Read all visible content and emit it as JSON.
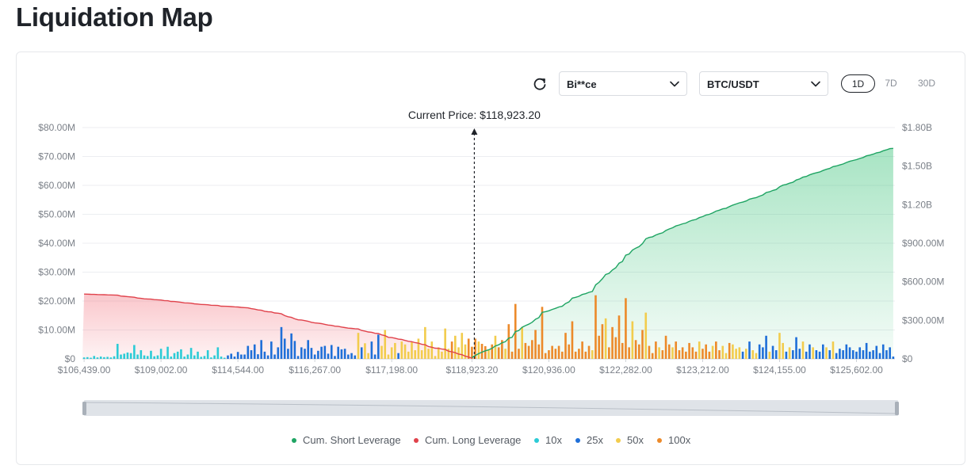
{
  "page": {
    "title": "Liquidation Map"
  },
  "controls": {
    "exchange": "Bi**ce",
    "pair": "BTC/USDT",
    "timeframes": [
      "1D",
      "7D",
      "30D"
    ],
    "active_timeframe": "1D"
  },
  "colors": {
    "short_line": "#1fa463",
    "short_fill": "#2fbf71",
    "long_line": "#e0424b",
    "long_fill": "#f26b77",
    "lev_10x": "#2ccbd6",
    "lev_25x": "#1f6fd8",
    "lev_50x": "#f2cc4d",
    "lev_100x": "#ec8a2a"
  },
  "chart_data": {
    "type": "bar",
    "current_price_label": "Current Price: $118,923.20",
    "current_price_index": 116,
    "y_left": {
      "min": 0,
      "max": 80,
      "unit": "M USD",
      "ticks": [
        "$0",
        "$10.00M",
        "$20.00M",
        "$30.00M",
        "$40.00M",
        "$50.00M",
        "$60.00M",
        "$70.00M",
        "$80.00M"
      ]
    },
    "y_right": {
      "min": 0,
      "max": 1800,
      "unit": "M USD",
      "ticks": [
        "$0",
        "$300.00M",
        "$600.00M",
        "$900.00M",
        "$1.20B",
        "$1.50B",
        "$1.80B"
      ]
    },
    "x_tick_labels": [
      "$106,439.00",
      "$109,002.00",
      "$114,544.00",
      "$116,267.00",
      "$117,198.00",
      "$118,923.20",
      "$120,936.00",
      "$122,282.00",
      "$123,212.00",
      "$124,155.00",
      "$125,602.00"
    ],
    "x_tick_indices": [
      0,
      23,
      46,
      69,
      92,
      116,
      139,
      162,
      185,
      208,
      231
    ],
    "grid": true,
    "legend": [
      "Cum. Short Leverage",
      "Cum. Long Leverage",
      "10x",
      "25x",
      "50x",
      "100x"
    ],
    "legend_position": "bottom",
    "bar_leverage": [
      "10x",
      "10x",
      "10x",
      "10x",
      "10x",
      "10x",
      "10x",
      "10x",
      "10x",
      "10x",
      "10x",
      "10x",
      "10x",
      "10x",
      "10x",
      "10x",
      "10x",
      "10x",
      "10x",
      "10x",
      "10x",
      "10x",
      "10x",
      "10x",
      "10x",
      "10x",
      "10x",
      "10x",
      "10x",
      "10x",
      "10x",
      "10x",
      "10x",
      "10x",
      "10x",
      "10x",
      "10x",
      "10x",
      "10x",
      "10x",
      "10x",
      "10x",
      "10x",
      "25x",
      "25x",
      "25x",
      "25x",
      "25x",
      "25x",
      "25x",
      "25x",
      "25x",
      "25x",
      "25x",
      "25x",
      "25x",
      "25x",
      "25x",
      "25x",
      "25x",
      "25x",
      "25x",
      "25x",
      "25x",
      "25x",
      "25x",
      "25x",
      "25x",
      "25x",
      "25x",
      "25x",
      "25x",
      "25x",
      "25x",
      "25x",
      "25x",
      "25x",
      "25x",
      "25x",
      "25x",
      "25x",
      "25x",
      "50x",
      "25x",
      "50x",
      "50x",
      "25x",
      "25x",
      "25x",
      "50x",
      "50x",
      "50x",
      "50x",
      "50x",
      "25x",
      "50x",
      "50x",
      "50x",
      "50x",
      "50x",
      "50x",
      "50x",
      "50x",
      "50x",
      "50x",
      "50x",
      "50x",
      "50x",
      "50x",
      "50x",
      "100x",
      "50x",
      "50x",
      "50x",
      "50x",
      "100x",
      "100x",
      "100x",
      "50x",
      "100x",
      "100x",
      "50x",
      "100x",
      "50x",
      "100x",
      "100x",
      "50x",
      "100x",
      "100x",
      "100x",
      "100x",
      "50x",
      "100x",
      "100x",
      "100x",
      "100x",
      "100x",
      "100x",
      "100x",
      "100x",
      "100x",
      "100x",
      "100x",
      "100x",
      "100x",
      "100x",
      "100x",
      "100x",
      "100x",
      "100x",
      "100x",
      "100x",
      "50x",
      "100x",
      "100x",
      "100x",
      "50x",
      "100x",
      "100x",
      "100x",
      "100x",
      "100x",
      "100x",
      "100x",
      "50x",
      "100x",
      "100x",
      "100x",
      "50x",
      "100x",
      "100x",
      "100x",
      "50x",
      "100x",
      "100x",
      "100x",
      "50x",
      "100x",
      "100x",
      "100x",
      "100x",
      "100x",
      "100x",
      "100x",
      "50x",
      "100x",
      "100x",
      "100x",
      "50x",
      "100x",
      "100x",
      "50x",
      "50x",
      "100x",
      "50x",
      "50x",
      "50x",
      "25x",
      "50x",
      "25x",
      "50x",
      "50x",
      "25x",
      "25x",
      "25x",
      "50x",
      "25x",
      "25x",
      "50x",
      "50x",
      "25x",
      "50x",
      "25x",
      "25x",
      "25x",
      "50x",
      "25x",
      "25x",
      "50x",
      "25x",
      "25x",
      "25x",
      "50x",
      "25x",
      "50x",
      "25x",
      "25x",
      "25x",
      "25x",
      "25x",
      "25x",
      "25x",
      "25x",
      "25x",
      "25x",
      "25x",
      "25x",
      "25x",
      "25x",
      "25x",
      "25x",
      "25x",
      "25x",
      "25x",
      "25x",
      "25x",
      "10x"
    ],
    "bar_values": [
      0.5,
      0.6,
      0.4,
      1.0,
      0.5,
      0.8,
      0.6,
      0.7,
      0.5,
      0.9,
      5.2,
      1.5,
      1.8,
      2.2,
      2.0,
      4.8,
      1.5,
      3.0,
      1.2,
      1.0,
      2.8,
      0.9,
      1.2,
      3.5,
      1.0,
      4.2,
      0.8,
      2.0,
      2.5,
      3.3,
      0.8,
      1.5,
      3.8,
      1.2,
      2.5,
      0.7,
      1.0,
      3.0,
      0.5,
      1.2,
      4.0,
      0.8,
      0.4,
      1.2,
      1.8,
      0.8,
      2.4,
      1.5,
      1.5,
      4.5,
      3.0,
      5.0,
      1.6,
      6.5,
      2.5,
      1.2,
      6.0,
      1.5,
      4.0,
      11.0,
      7.0,
      3.5,
      8.8,
      6.2,
      1.0,
      4.0,
      3.5,
      6.5,
      3.8,
      1.5,
      2.8,
      4.2,
      4.5,
      1.8,
      4.8,
      1.0,
      4.2,
      3.3,
      3.5,
      1.5,
      2.0,
      1.2,
      9.0,
      4.0,
      5.4,
      2.0,
      6.0,
      1.5,
      8.4,
      4.5,
      10.0,
      1.5,
      4.0,
      5.5,
      2.0,
      6.0,
      5.0,
      2.5,
      6.0,
      3.0,
      7.0,
      3.0,
      11.0,
      3.5,
      6.0,
      1.0,
      4.0,
      2.5,
      10.5,
      3.5,
      6.0,
      8.0,
      4.0,
      9.0,
      5.0,
      7.0,
      4.2,
      7.0,
      6.0,
      5.2,
      4.4,
      3.0,
      5.0,
      8.0,
      4.0,
      6.5,
      3.5,
      12.0,
      2.5,
      19.0,
      3.5,
      11.0,
      5.5,
      4.5,
      6.5,
      10.0,
      5.0,
      18.0,
      2.0,
      3.0,
      4.5,
      3.5,
      4.5,
      2.5,
      9.0,
      5.0,
      13.0,
      2.5,
      3.5,
      6.0,
      2.5,
      4.5,
      3.0,
      22.0,
      8.0,
      12.0,
      14.0,
      4.0,
      11.0,
      7.5,
      15.0,
      5.5,
      21.0,
      4.0,
      13.0,
      6.5,
      5.0,
      10.0,
      16.0,
      4.5,
      2.0,
      6.0,
      4.0,
      3.0,
      8.0,
      5.0,
      4.0,
      6.0,
      3.0,
      4.0,
      2.5,
      5.5,
      4.0,
      2.5,
      6.0,
      3.5,
      5.0,
      2.5,
      4.5,
      6.0,
      3.0,
      4.5,
      2.0,
      5.5,
      5.0,
      3.5,
      4.0,
      2.5,
      3.5,
      6.0,
      3.0,
      2.0,
      5.0,
      4.0,
      8.0,
      2.5,
      4.5,
      3.0,
      9.0,
      5.5,
      2.5,
      4.0,
      3.0,
      7.5,
      3.5,
      6.0,
      2.5,
      5.0,
      4.0,
      3.0,
      2.5,
      5.0,
      4.0,
      3.0,
      6.0,
      2.0,
      3.5,
      3.0,
      5.0,
      4.0,
      3.0,
      2.5,
      4.0,
      3.0,
      5.5,
      2.5,
      3.0,
      4.5,
      2.0,
      5.0,
      3.0,
      4.0,
      0.8
    ]
  }
}
